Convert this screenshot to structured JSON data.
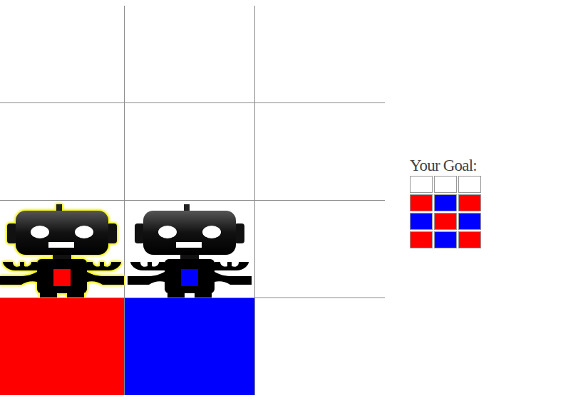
{
  "board": {
    "rows": [
      [
        {
          "color": "#ffffff",
          "robot": null
        },
        {
          "color": "#ffffff",
          "robot": null
        },
        {
          "color": "#ffffff",
          "robot": null
        }
      ],
      [
        {
          "color": "#ffffff",
          "robot": null
        },
        {
          "color": "#ffffff",
          "robot": null
        },
        {
          "color": "#ffffff",
          "robot": null
        }
      ],
      [
        {
          "color": "#ffffff",
          "robot": {
            "color": "#ff0000",
            "selected": true
          }
        },
        {
          "color": "#ffffff",
          "robot": {
            "color": "#0000ff",
            "selected": false
          }
        },
        {
          "color": "#ffffff",
          "robot": null
        }
      ],
      [
        {
          "color": "#ff0000",
          "robot": null
        },
        {
          "color": "#0000ff",
          "robot": null
        },
        {
          "color": "#ffffff",
          "robot": null
        }
      ]
    ]
  },
  "goal": {
    "title": "Your Goal:",
    "rows": [
      [
        {
          "color": "#ffffff"
        },
        {
          "color": "#ffffff"
        },
        {
          "color": "#ffffff"
        }
      ],
      [
        {
          "color": "#ff0000"
        },
        {
          "color": "#0000ff"
        },
        {
          "color": "#ff0000"
        }
      ],
      [
        {
          "color": "#0000ff"
        },
        {
          "color": "#ff0000"
        },
        {
          "color": "#0000ff"
        }
      ],
      [
        {
          "color": "#ff0000"
        },
        {
          "color": "#0000ff"
        },
        {
          "color": "#ff0000"
        }
      ]
    ]
  }
}
